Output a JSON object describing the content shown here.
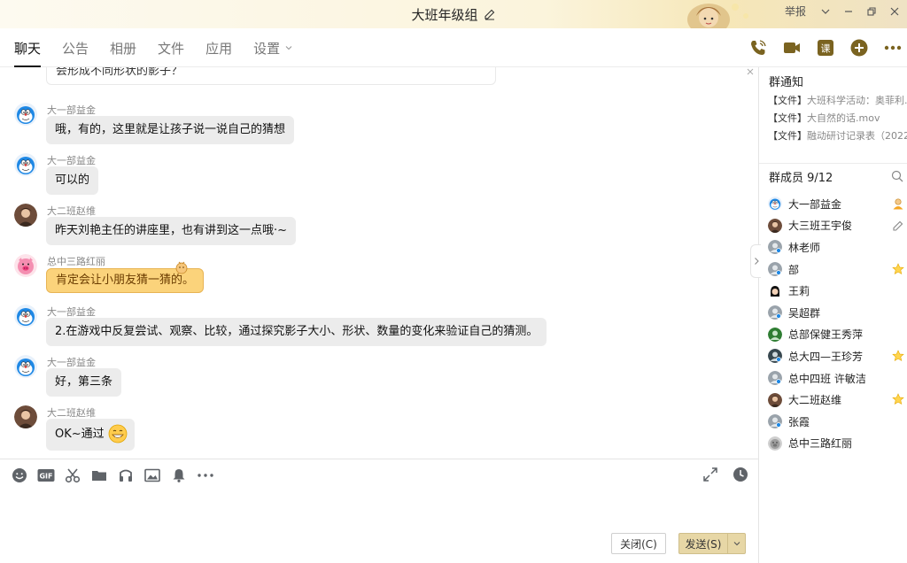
{
  "window": {
    "title": "大班年级组",
    "report_label": "举报"
  },
  "nav": {
    "tabs": [
      {
        "label": "聊天",
        "active": true
      },
      {
        "label": "公告"
      },
      {
        "label": "相册"
      },
      {
        "label": "文件"
      },
      {
        "label": "应用"
      },
      {
        "label": "设置",
        "has_dropdown": true
      }
    ],
    "right_icons": [
      "phone-icon",
      "video-call-icon",
      "lesson-icon",
      "add-icon",
      "more-icon"
    ],
    "lesson_label": "课"
  },
  "chat": {
    "partial_top_text": "会形成不同形状的影子？",
    "messages": [
      {
        "sender": "大一部益金",
        "text": "哦，有的，这里就是让孩子说一说自己的猜想",
        "avatar": "doraemon"
      },
      {
        "sender": "大一部益金",
        "text": "可以的",
        "avatar": "doraemon"
      },
      {
        "sender": "大二班赵维",
        "text": "昨天刘艳主任的讲座里，也有讲到这一点哦·~",
        "avatar": "photo"
      },
      {
        "sender": "总中三路红丽",
        "text": "肯定会让小朋友猜一猜的。",
        "avatar": "pig",
        "style": "yellow"
      },
      {
        "sender": "大一部益金",
        "text": "2.在游戏中反复尝试、观察、比较，通过探究影子大小、形状、数量的变化来验证自己的猜测。",
        "avatar": "doraemon"
      },
      {
        "sender": "大一部益金",
        "text": "好，第三条",
        "avatar": "doraemon"
      },
      {
        "sender": "大二班赵维",
        "text": "OK~通过",
        "avatar": "photo",
        "emoji": "grin-emoji"
      }
    ]
  },
  "toolbar": {
    "tools": [
      "emoji-icon",
      "gif-icon",
      "screenshot-scissors-icon",
      "folder-icon",
      "music-icon",
      "image-icon",
      "bell-icon",
      "more-tools-icon"
    ],
    "right_tools": [
      "expand-icon",
      "history-clock-icon"
    ],
    "gif_label": "GIF"
  },
  "input": {
    "close_label": "关闭(C)",
    "send_label": "发送(S)"
  },
  "side": {
    "notice_title": "群通知",
    "notices": [
      {
        "prefix": "【文件】",
        "name": "大班科学活动：奥菲利..."
      },
      {
        "prefix": "【文件】",
        "name": "大自然的话.mov"
      },
      {
        "prefix": "【文件】",
        "name": "融动研讨记录表（2022..."
      }
    ],
    "members_title": "群成员 9/12",
    "members": [
      {
        "name": "大一部益金",
        "badge": "owner-icon",
        "avatar": "doraemon"
      },
      {
        "name": "大三班王宇俊",
        "badge": "edit-icon",
        "avatar": "photo"
      },
      {
        "name": "林老师",
        "avatar": "generic"
      },
      {
        "name": "部",
        "badge": "star-icon",
        "avatar": "generic"
      },
      {
        "name": "王莉",
        "avatar": "girl"
      },
      {
        "name": "吴超群",
        "avatar": "generic"
      },
      {
        "name": "总部保健王秀萍",
        "avatar": "green"
      },
      {
        "name": "总大四—王珍芳",
        "badge": "star-icon",
        "avatar": "dark"
      },
      {
        "name": "总中四班 许敏洁",
        "avatar": "generic"
      },
      {
        "name": "大二班赵维",
        "badge": "star-icon",
        "avatar": "photo"
      },
      {
        "name": "张霞",
        "avatar": "generic"
      },
      {
        "name": "总中三路红丽",
        "avatar": "pig-gray"
      }
    ]
  },
  "colors": {
    "accent_gold": "#d4a017",
    "icon_green": "#7a6320",
    "bubble_gray": "#ececec",
    "bubble_yellow": "#fbd37b",
    "send_button": "#e7d7a6"
  }
}
